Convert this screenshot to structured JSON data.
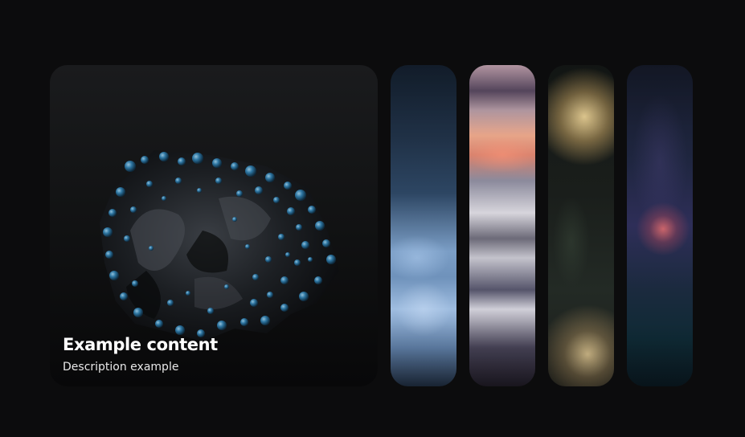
{
  "active_card": {
    "title": "Example content",
    "description": "Description example"
  },
  "thumbnails": [
    {
      "name": "blue-abstract"
    },
    {
      "name": "pink-striped-abstract"
    },
    {
      "name": "bokeh-lights"
    },
    {
      "name": "purple-night-abstract"
    }
  ],
  "colors": {
    "background": "#0c0c0d",
    "title": "#ffffff",
    "description": "#e8e8e8",
    "bubble_accent": "#2f7fb0"
  }
}
